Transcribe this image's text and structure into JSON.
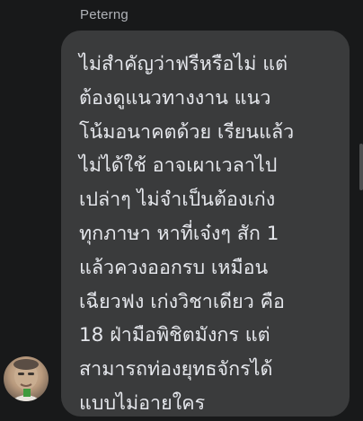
{
  "sender": {
    "name": "Peterng"
  },
  "message": {
    "lines": [
      "ไม่สำคัญว่าฟรีหรือไม่ แต่",
      "ต้องดูแนวทางงาน แนว",
      "โน้มอนาคตด้วย เรียนแล้ว",
      "ไม่ได้ใช้ อาจเผาเวลาไป",
      "เปล่าๆ ไม่จำเป็นต้องเก่ง",
      "ทุกภาษา หาที่เจ๋งๆ สัก 1",
      "แล้วควงออกรบ เหมือน",
      "เฉียวฟง เก่งวิชาเดียว คือ",
      "18 ฝ่ามือพิชิตมังกร แต่",
      "สามารถท่องยุทธจักรได้",
      "แบบไม่อายใคร"
    ]
  },
  "colors": {
    "background": "#18191a",
    "bubble": "#3a3b3c",
    "text": "#e4e6eb",
    "sender_name": "#b0b3b8"
  }
}
